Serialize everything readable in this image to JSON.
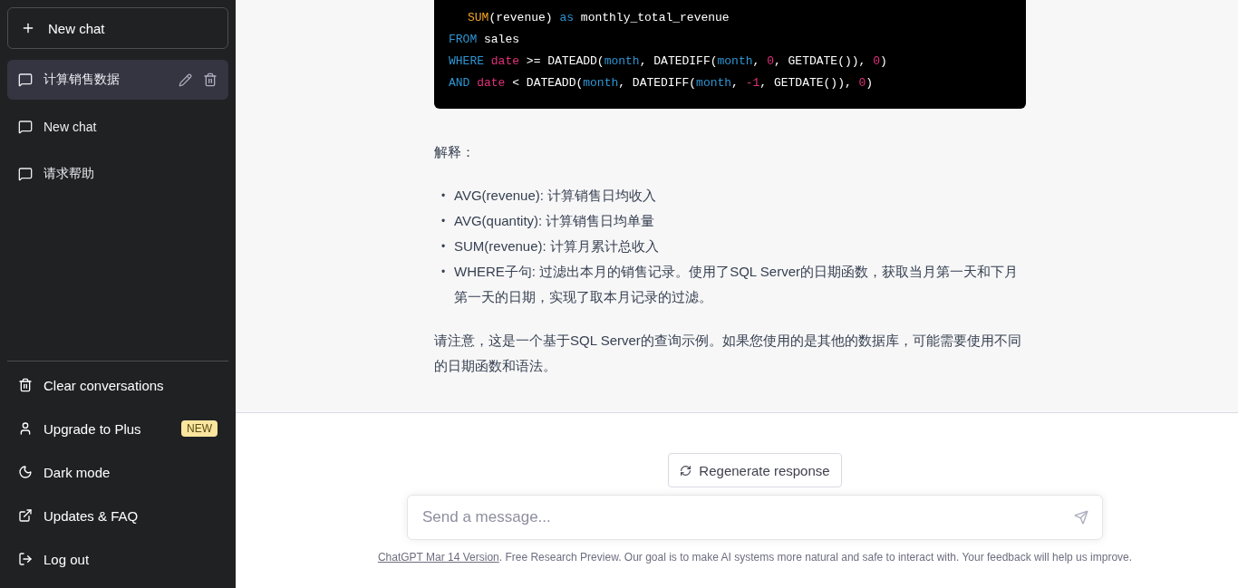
{
  "sidebar": {
    "new_chat_button": {
      "label": "New chat"
    },
    "conversations": [
      {
        "title": "计算销售数据",
        "selected": true
      },
      {
        "title": "New chat",
        "selected": false
      },
      {
        "title": "请求帮助",
        "selected": false
      }
    ],
    "actions": [
      {
        "kind": "trash",
        "label": "Clear conversations"
      },
      {
        "kind": "user",
        "label": "Upgrade to Plus",
        "badge": "NEW"
      },
      {
        "kind": "moon",
        "label": "Dark mode"
      },
      {
        "kind": "external",
        "label": "Updates & FAQ"
      },
      {
        "kind": "logout",
        "label": "Log out"
      }
    ]
  },
  "chat": {
    "code_lines": [
      {
        "indent": true,
        "tokens": [
          {
            "kind": "function",
            "text": "SUM"
          },
          {
            "kind": "plain",
            "text": "(revenue) "
          },
          {
            "kind": "keyword",
            "text": "as"
          },
          {
            "kind": "plain",
            "text": " monthly_total_revenue"
          }
        ]
      },
      {
        "indent": false,
        "tokens": [
          {
            "kind": "keyword",
            "text": "FROM"
          },
          {
            "kind": "plain",
            "text": " sales"
          }
        ]
      },
      {
        "indent": false,
        "tokens": [
          {
            "kind": "keyword",
            "text": "WHERE"
          },
          {
            "kind": "literal",
            "text": "date",
            "space": true
          },
          {
            "kind": "plain",
            "text": " >= DATEADD("
          },
          {
            "kind": "keyword",
            "text": "month"
          },
          {
            "kind": "plain",
            "text": ", DATEDIFF("
          },
          {
            "kind": "keyword",
            "text": "month"
          },
          {
            "kind": "plain",
            "text": ", "
          },
          {
            "kind": "literal",
            "text": "0"
          },
          {
            "kind": "plain",
            "text": ", GETDATE()), "
          },
          {
            "kind": "literal",
            "text": "0"
          },
          {
            "kind": "plain",
            "text": ")"
          }
        ]
      },
      {
        "indent": false,
        "tokens": [
          {
            "kind": "keyword",
            "text": "AND"
          },
          {
            "kind": "literal",
            "text": "date",
            "space": true
          },
          {
            "kind": "plain",
            "text": " < DATEADD("
          },
          {
            "kind": "keyword",
            "text": "month"
          },
          {
            "kind": "plain",
            "text": ", DATEDIFF("
          },
          {
            "kind": "keyword",
            "text": "month"
          },
          {
            "kind": "plain",
            "text": ", "
          },
          {
            "kind": "literal",
            "text": "-1"
          },
          {
            "kind": "plain",
            "text": ", GETDATE()), "
          },
          {
            "kind": "literal",
            "text": "0"
          },
          {
            "kind": "plain",
            "text": ")"
          }
        ]
      }
    ],
    "explanation_heading": "解释：",
    "bullets": [
      {
        "marker": "•",
        "text": "AVG(revenue): 计算销售日均收入"
      },
      {
        "marker": "•",
        "text": "AVG(quantity): 计算销售日均单量"
      },
      {
        "marker": "•",
        "text": "SUM(revenue): 计算月累计总收入"
      },
      {
        "marker": "•",
        "text": "WHERE子句: 过滤出本月的销售记录。使用了SQL Server的日期函数，获取当月第一天和下月第一天的日期，实现了取本月记录的过滤。"
      }
    ],
    "note": "请注意，这是一个基于SQL Server的查询示例。如果您使用的是其他的数据库，可能需要使用不同的日期函数和语法。"
  },
  "composer": {
    "regenerate_button": "Regenerate response",
    "placeholder": "Send a message...",
    "footer_link": "ChatGPT Mar 14 Version",
    "footer_text": ". Free Research Preview. Our goal is to make AI systems more natural and safe to interact with. Your feedback will help us improve."
  }
}
